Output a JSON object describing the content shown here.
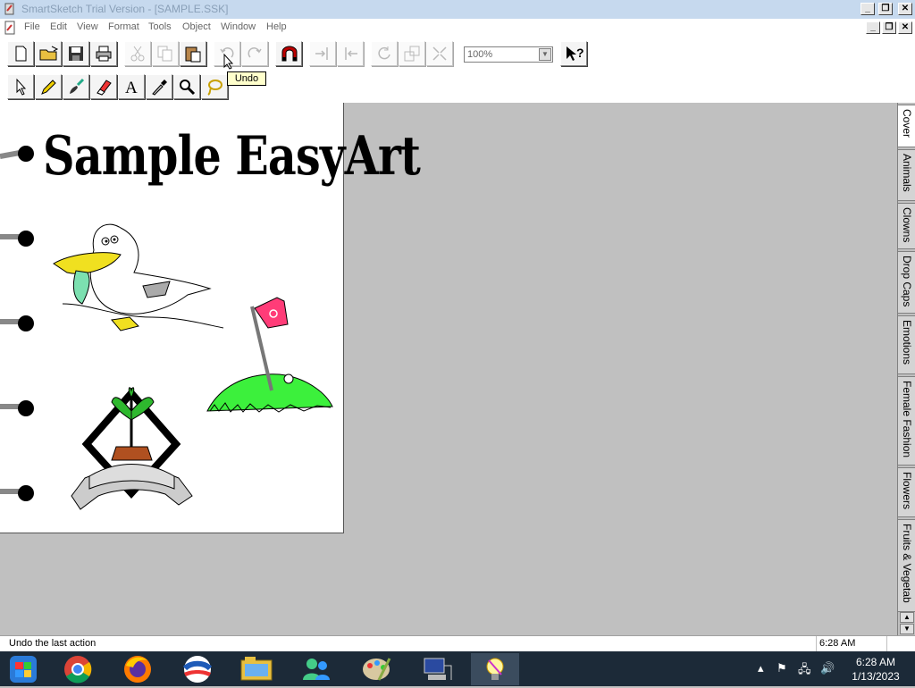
{
  "window": {
    "title": "SmartSketch Trial Version - [SAMPLE.SSK]"
  },
  "menu": [
    "File",
    "Edit",
    "View",
    "Format",
    "Tools",
    "Object",
    "Window",
    "Help"
  ],
  "toolbar": {
    "zoom_value": "100%",
    "tooltip": "Undo"
  },
  "page": {
    "title": "Sample EasyArt"
  },
  "tabs": [
    "Cover",
    "Animals",
    "Clowns",
    "Drop Caps",
    "Emotions",
    "Female Fashion",
    "Flowers",
    "Fruits & Vegetab"
  ],
  "status": {
    "message": "Undo the last action",
    "time": "6:28 AM"
  },
  "taskbar": {
    "clock_time": "6:28 AM",
    "clock_date": "1/13/2023"
  },
  "colors": {
    "title_bar": "#c6d9ee",
    "taskbar": "#1c2a38",
    "tooltip": "#ffffcc",
    "grass": "#3cf03c",
    "flag": "#ff3c78"
  }
}
